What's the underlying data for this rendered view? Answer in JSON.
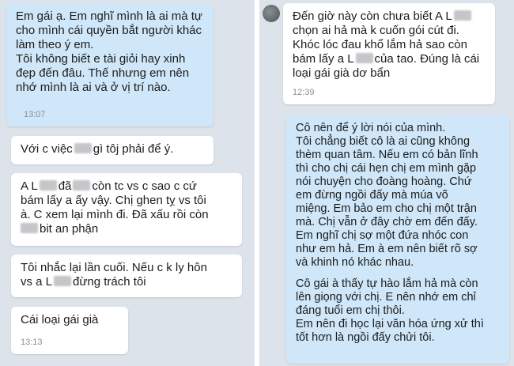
{
  "left_chat": {
    "msg1": {
      "lines": [
        "Em gái ạ. Em nghĩ mình là ai mà tự",
        "cho mình cái quyền bắt người khác",
        "làm theo ý em.",
        "Tôi không biết e tài giỏi hay xinh",
        "đẹp đến đâu. Thế nhưng em nên",
        "nhớ mình là ai và ở vị trí nào."
      ],
      "time": "13:07"
    },
    "msg2": {
      "before": "Với c việc",
      "after": "gì tôj phải để ý."
    },
    "msg3": {
      "l1_a": "A L",
      "l1_b": "đã",
      "l1_c": "còn tc vs c sao c cứ",
      "l2": "bám lấy a ấy vậy. Chị ghen tỵ vs tôi",
      "l3": "à. C xem lại mình đi. Đã xấu rồi còn",
      "l4": "bit an phận"
    },
    "msg4": {
      "l1": "Tôi nhắc lại lần cuối. Nếu c k ly hôn",
      "l2_a": "vs a L",
      "l2_b": "đừng trách tôi"
    },
    "msg5": {
      "text": "Cái loại gái già",
      "time": "13:13"
    }
  },
  "right_chat": {
    "msg1": {
      "l1": "Đến giờ này còn chưa biết A L",
      "l2": "chọn ai hả mà k cuốn gói cút đi.",
      "l3": "Khóc lóc đau khổ lắm hả sao còn",
      "l4_a": "bám lấy a L",
      "l4_b": "của tao. Đúng là cái",
      "l5": "loại gái già dơ bẩn",
      "time": "12:39"
    },
    "msg2": {
      "lines": [
        "Cô nên để ý lời nói của mình.",
        "Tôi chẳng biết cô là ai cũng không",
        "thèm quan tâm. Nếu em có bản lĩnh",
        "thì cho chị cái hẹn chị em mình gặp",
        "nói chuyện cho đoàng hoàng. Chứ",
        "em đừng ngồi đấy mà múa võ",
        "miệng. Em bảo em cho chị một trận",
        "mà. Chị vẫn ở đây chờ em đến đấy.",
        "Em nghĩ chị sợ một đứa nhóc con",
        "như em hả. Em à em nên biết rõ sợ",
        "và khinh nó khác nhau."
      ],
      "lines2": [
        "Cô gái à thấy tự hào lắm hả mà còn",
        "lên giọng với chị. E nên nhớ em chỉ",
        "đáng tuổi em chị thôi.",
        "Em nên đi học lại văn hóa ứng xử thì",
        "tốt hơn là ngồi đấy chửi tôi."
      ]
    }
  },
  "colors": {
    "outgoing": "#cfe7f9",
    "incoming": "#ffffff",
    "background": "#dde3ea"
  }
}
